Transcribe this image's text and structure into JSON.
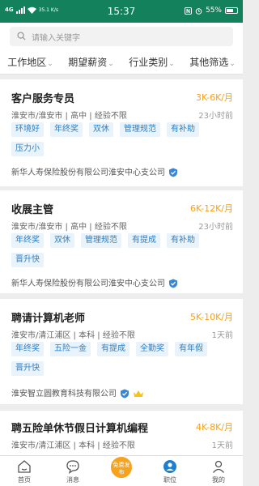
{
  "status_bar": {
    "network": "4G",
    "speed": "35.1 K/s",
    "time": "15:37",
    "battery": "55%"
  },
  "search": {
    "placeholder": "请输入关键字"
  },
  "filters": [
    "工作地区",
    "期望薪资",
    "行业类别",
    "其他筛选"
  ],
  "jobs": [
    {
      "title": "客户服务专员",
      "salary": "3K-6K/月",
      "meta": "淮安市/淮安市 | 高中 | 经验不限",
      "time": "23小时前",
      "tags": [
        "环境好",
        "年终奖",
        "双休",
        "管理规范",
        "有补助",
        "压力小"
      ],
      "company": "新华人寿保险股份有限公司淮安中心支公司"
    },
    {
      "title": "收展主管",
      "salary": "6K-12K/月",
      "meta": "淮安市/淮安市 | 高中 | 经验不限",
      "time": "23小时前",
      "tags": [
        "年终奖",
        "双休",
        "管理规范",
        "有提成",
        "有补助",
        "晋升快"
      ],
      "company": "新华人寿保险股份有限公司淮安中心支公司"
    },
    {
      "title": "聘请计算机老师",
      "salary": "5K-10K/月",
      "meta": "淮安市/清江浦区 | 本科 | 经验不限",
      "time": "1天前",
      "tags": [
        "年终奖",
        "五险一金",
        "有提成",
        "全勤奖",
        "有年假",
        "晋升快"
      ],
      "company": "淮安智立圆教育科技有限公司"
    },
    {
      "title": "聘五险单休节假日计算机编程",
      "salary": "4K-8K/月",
      "meta": "淮安市/清江浦区 | 本科 | 经验不限",
      "time": "1天前",
      "tags": [],
      "company": ""
    }
  ],
  "tabbar": {
    "home": "首页",
    "messages": "消息",
    "post": "免费发布",
    "jobs": "职位",
    "mine": "我的"
  },
  "colors": {
    "status_bar": "#13815b",
    "salary": "#f5a21a",
    "tag_text": "#2e7fc3",
    "tag_bg": "#e9f3fb",
    "active_tab": "#1c7fd1",
    "post_button": "#f7a21b"
  }
}
